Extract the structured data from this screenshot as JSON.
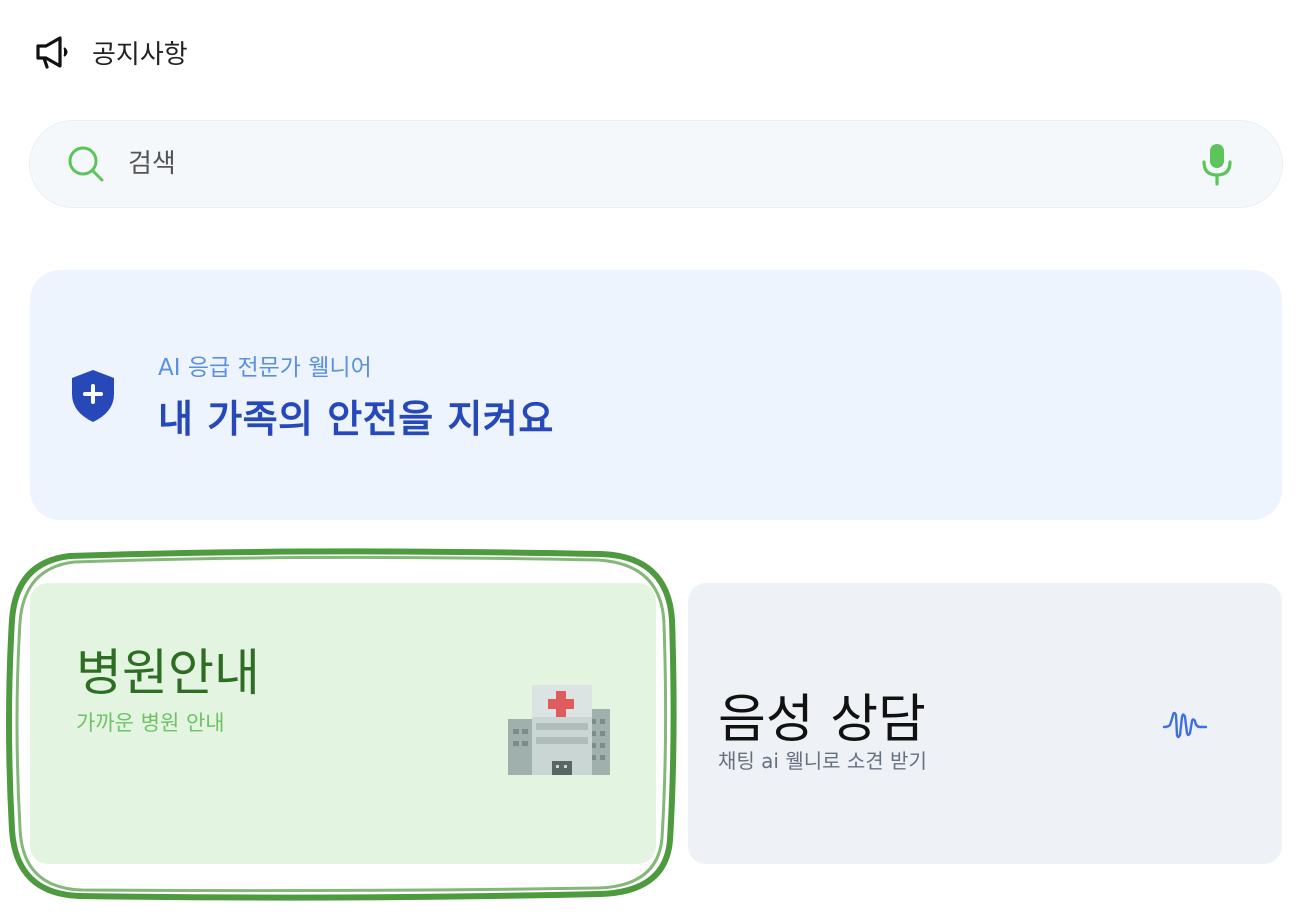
{
  "notice": {
    "icon": "megaphone-icon",
    "label": "공지사항"
  },
  "search": {
    "icon": "search-icon",
    "placeholder": "검색",
    "value": "",
    "mic_icon": "microphone-icon"
  },
  "banner": {
    "icon": "shield-plus-icon",
    "subtitle": "AI 응급 전문가 웰니어",
    "title": "내 가족의 안전을 지켜요"
  },
  "cards": [
    {
      "id": "hospital",
      "title": "병원안내",
      "subtitle": "가까운 병원 안내",
      "icon": "hospital-icon",
      "highlighted": true
    },
    {
      "id": "voice",
      "title": "음성 상담",
      "subtitle": "채팅 ai 웰니로 소견 받기",
      "icon": "voice-wave-icon"
    }
  ],
  "colors": {
    "accent_green": "#5cc45a",
    "banner_bg": "#edf4fd",
    "banner_title": "#2748b8",
    "banner_subtitle": "#5b8fe0",
    "hospital_card_bg": "#e3f5e1",
    "hospital_title": "#2f6d25",
    "voice_card_bg": "#eef2f7",
    "highlight_stroke": "#4e9a3f",
    "wave_color": "#3f6fe0"
  }
}
